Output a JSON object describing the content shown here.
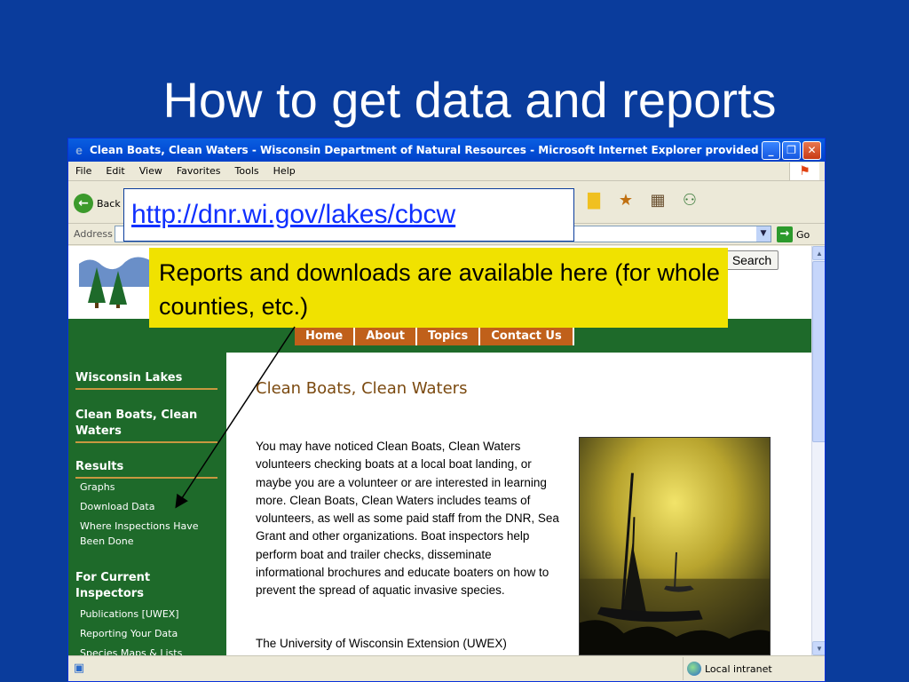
{
  "slide": {
    "title": "How to get data and reports"
  },
  "browser": {
    "window_title": "Clean Boats, Clean Waters - Wisconsin Department of Natural Resources - Microsoft Internet Explorer provided ...",
    "menu": [
      "File",
      "Edit",
      "View",
      "Favorites",
      "Tools",
      "Help"
    ],
    "back_label": "Back",
    "address_label": "Address",
    "go_label": "Go",
    "status_zone": "Local intranet"
  },
  "site": {
    "search_button": "Search",
    "nav_tabs": [
      "Home",
      "About",
      "Topics",
      "Contact Us"
    ],
    "sidebar": {
      "section_1": "Wisconsin Lakes",
      "section_2": "Clean Boats, Clean Waters",
      "section_3": "Results",
      "results_links": [
        "Graphs",
        "Download Data",
        "Where Inspections Have Been Done"
      ],
      "section_4": "For Current Inspectors",
      "inspector_links": [
        "Publications [UWEX]",
        "Reporting Your Data",
        "Species Maps & Lists"
      ]
    },
    "page_heading": "Clean Boats, Clean Waters",
    "intro_paragraph": "You may have noticed Clean Boats, Clean Waters volunteers checking boats at a local boat landing, or maybe you are a volunteer or are interested in learning more. Clean Boats, Clean Waters includes teams of volunteers, as well as some paid staff from the DNR, Sea Grant and other organizations. Boat inspectors help perform boat and trailer checks, disseminate informational brochures and educate boaters on how to prevent the spread of aquatic invasive species.",
    "uwex_paragraph": "The University of Wisconsin Extension (UWEX)"
  },
  "callouts": {
    "url": "http://dnr.wi.gov/lakes/cbcw",
    "note": "Reports and downloads are available here (for whole counties, etc.)"
  },
  "colors": {
    "slide_background": "#0a3c9c",
    "site_green": "#1e6a2a",
    "nav_orange": "#c0601a",
    "heading_brown": "#7b4a10",
    "callout_yellow": "#f0e200",
    "link_blue": "#1030ff"
  }
}
